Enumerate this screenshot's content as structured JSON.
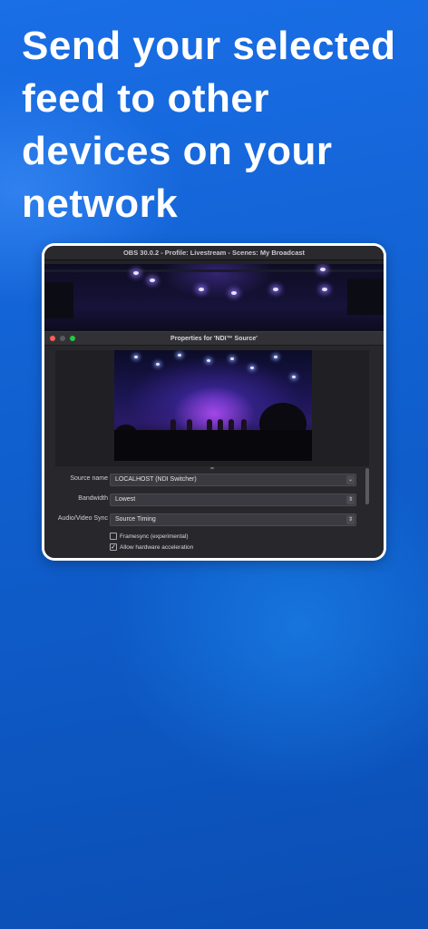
{
  "headline": "Send your selected feed to other devices on your network",
  "obs": {
    "window_title": "OBS 30.0.2 - Profile: Livestream - Scenes: My Broadcast"
  },
  "dialog": {
    "title": "Properties for 'NDI™ Source'",
    "fields": {
      "source_name": {
        "label": "Source name",
        "value": "LOCALHOST (NDI Switcher)"
      },
      "bandwidth": {
        "label": "Bandwidth",
        "value": "Lowest"
      },
      "av_sync": {
        "label": "Audio/Video Sync",
        "value": "Source Timing"
      }
    },
    "checkboxes": {
      "framesync": {
        "label": "Framesync (experimental)",
        "checked": false
      },
      "hw_accel": {
        "label": "Allow hardware acceleration",
        "checked": true
      }
    }
  },
  "colors": {
    "background": "#1364d6",
    "traffic_red": "#fe5f57",
    "traffic_yellow": "#febc2e",
    "traffic_green": "#28c840"
  },
  "icons": {
    "dropdown": "chevron-down-icon",
    "stepper": "up-down-chevron-icon",
    "checkmark": "checkmark-icon"
  }
}
